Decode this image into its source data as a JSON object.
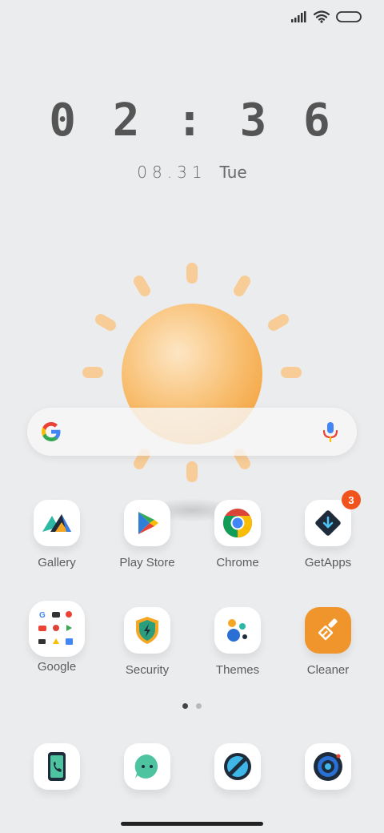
{
  "status_bar": {
    "icons": [
      "signal-icon",
      "wifi-icon",
      "battery-icon"
    ]
  },
  "lockscreen": {
    "time": "02:36",
    "date": "08.31",
    "weekday": "Tue"
  },
  "weather": {
    "icon": "sun-icon",
    "color": "#f4a23c"
  },
  "search": {
    "icons": [
      "google-g-icon",
      "microphone-icon"
    ]
  },
  "apps_row1": [
    {
      "label": "Gallery"
    },
    {
      "label": "Play Store"
    },
    {
      "label": "Chrome"
    },
    {
      "label": "GetApps",
      "badge": "3"
    }
  ],
  "apps_row2": [
    {
      "label": "Google"
    },
    {
      "label": "Security"
    },
    {
      "label": "Themes"
    },
    {
      "label": "Cleaner"
    }
  ],
  "dock": [
    {
      "icon": "phone-icon"
    },
    {
      "icon": "messaging-icon"
    },
    {
      "icon": "browser-icon"
    },
    {
      "icon": "camera-icon"
    }
  ],
  "page_indicator": {
    "pages": 2,
    "current": 1
  },
  "colors": {
    "background": "#ebecee",
    "badge": "#f0541c",
    "cleaner": "#f0952c"
  }
}
